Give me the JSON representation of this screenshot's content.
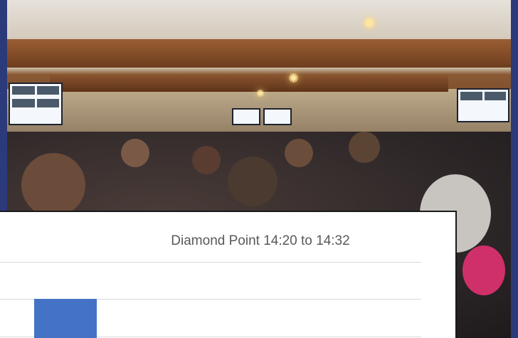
{
  "chart_data": {
    "type": "bar",
    "title": "Diamond Point 14:20 to 14:32",
    "series": [
      {
        "values": [
          1
        ]
      }
    ],
    "colors": {
      "bar": "#4472c4",
      "grid": "#d9d9d9",
      "title": "#595959"
    }
  },
  "scene": {
    "description_icons": [
      "meeting-photo-icon",
      "chandelier-icon",
      "projection-screen-icon"
    ]
  }
}
